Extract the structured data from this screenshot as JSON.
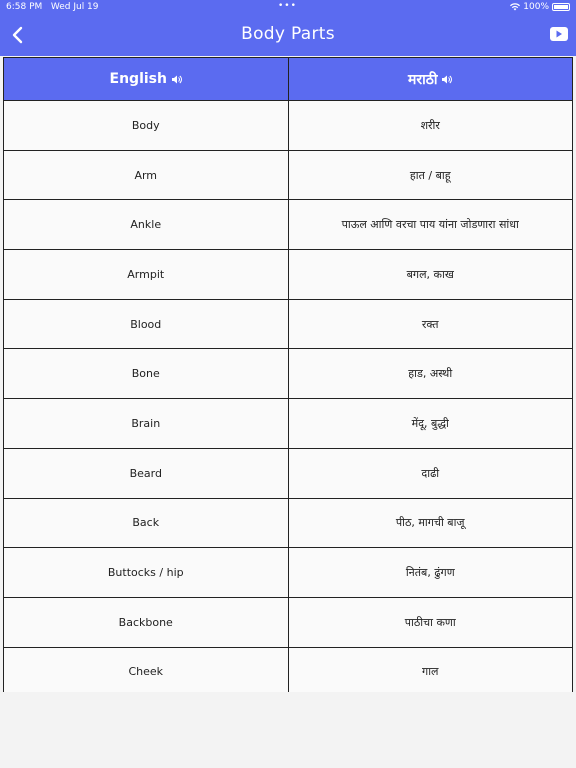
{
  "status_bar": {
    "time": "6:58 PM",
    "date": "Wed Jul 19",
    "battery": "100%"
  },
  "header": {
    "title": "Body Parts",
    "back_icon": "chevron-left-icon",
    "video_icon": "youtube-icon"
  },
  "colors": {
    "accent": "#5b6bf0",
    "border": "#222222",
    "cell_bg": "#fafafa"
  },
  "table": {
    "columns": [
      "English",
      "मराठी"
    ],
    "rows": [
      [
        "Body",
        "शरीर"
      ],
      [
        "Arm",
        "हात / बाहू"
      ],
      [
        "Ankle",
        "पाऊल आणि वरचा पाय यांना जोडणारा सांधा"
      ],
      [
        "Armpit",
        "बगल, काख"
      ],
      [
        "Blood",
        "रक्त"
      ],
      [
        "Bone",
        "हाड, अस्थी"
      ],
      [
        "Brain",
        "मेंदू, बुद्धी"
      ],
      [
        "Beard",
        "दाढी"
      ],
      [
        "Back",
        "पीठ, मागची बाजू"
      ],
      [
        "Buttocks / hip",
        "नितंब, ढुंगण"
      ],
      [
        "Backbone",
        "पाठीचा कणा"
      ],
      [
        "Cheek",
        "गाल"
      ]
    ]
  }
}
